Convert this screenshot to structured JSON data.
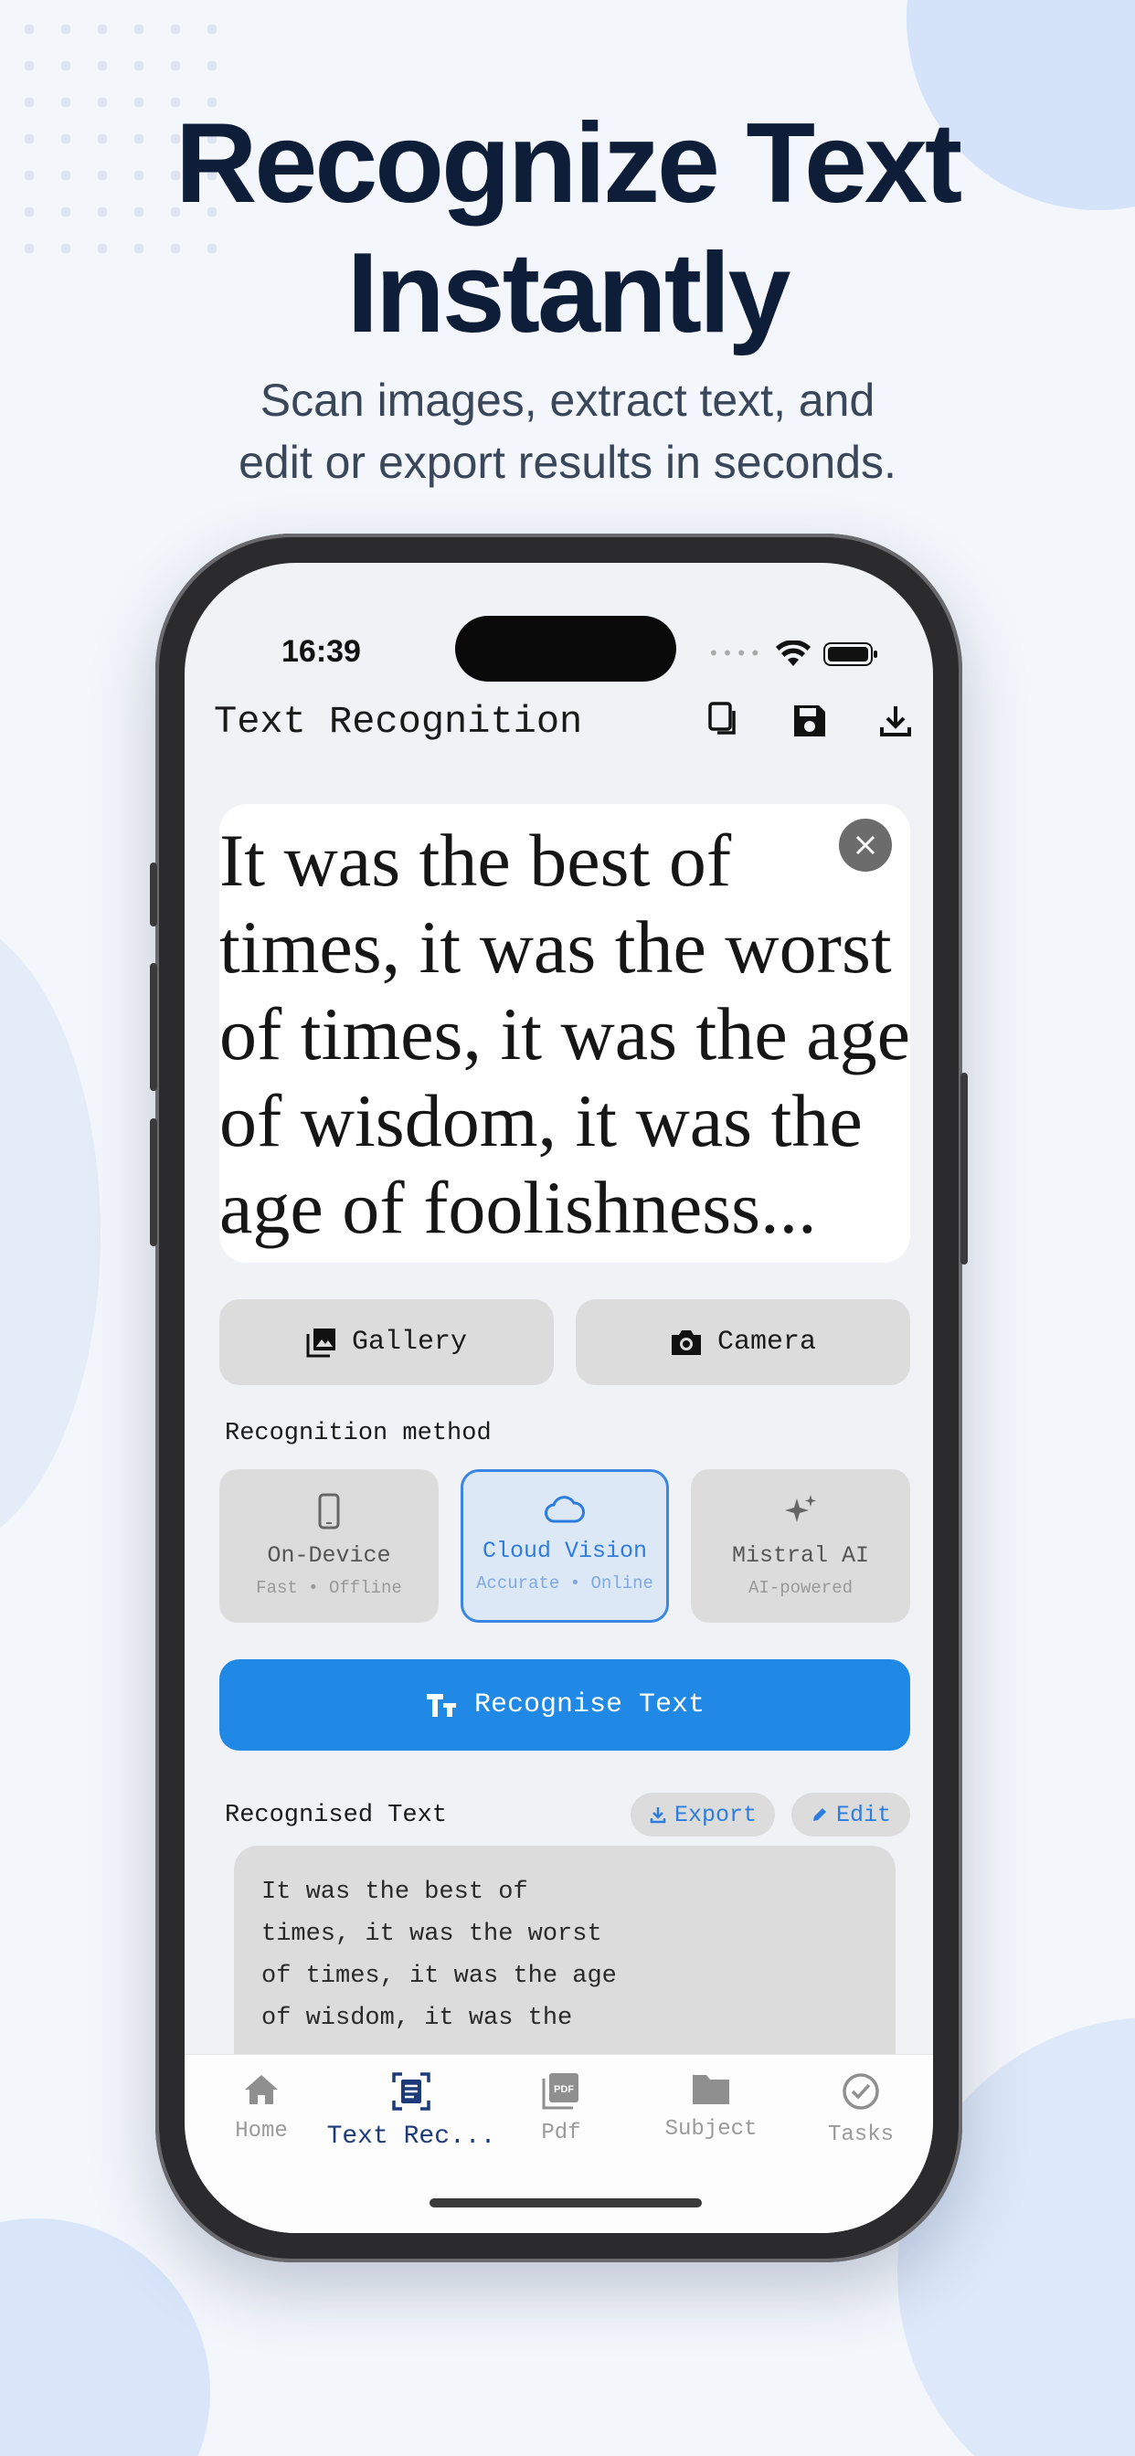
{
  "hero": {
    "headline_line1": "Recognize Text",
    "headline_line2": "Instantly",
    "sub_line1": "Scan images, extract text, and",
    "sub_line2": "edit or export results in seconds."
  },
  "status_bar": {
    "time": "16:39"
  },
  "app_bar": {
    "title": "Text Recognition",
    "icons": [
      "copy-icon",
      "save-icon",
      "download-icon"
    ]
  },
  "preview": {
    "lines": [
      "It was the best of",
      "times, it was the worst",
      "of times, it was the age",
      "of wisdom, it was the",
      "age of foolishness..."
    ]
  },
  "source_buttons": {
    "gallery": "Gallery",
    "camera": "Camera"
  },
  "recognition": {
    "label": "Recognition method",
    "methods": [
      {
        "title": "On-Device",
        "subtitle": "Fast • Offline",
        "icon": "phone-icon",
        "selected": false
      },
      {
        "title": "Cloud Vision",
        "subtitle": "Accurate • Online",
        "icon": "cloud-icon",
        "selected": true
      },
      {
        "title": "Mistral AI",
        "subtitle": "AI-powered",
        "icon": "sparkle-icon",
        "selected": false
      }
    ],
    "action_label": "Recognise Text"
  },
  "result": {
    "label": "Recognised Text",
    "export_label": "Export",
    "edit_label": "Edit",
    "lines": [
      "It was the best of",
      "times, it was the worst",
      "of times, it was the age",
      "of wisdom, it was the"
    ]
  },
  "tabs": [
    {
      "label": "Home",
      "icon": "home-icon",
      "active": false
    },
    {
      "label": "Text Rec...",
      "icon": "document-scan-icon",
      "active": true
    },
    {
      "label": "Pdf",
      "icon": "pdf-icon",
      "active": false
    },
    {
      "label": "Subject",
      "icon": "folder-icon",
      "active": false
    },
    {
      "label": "Tasks",
      "icon": "check-circle-icon",
      "active": false
    }
  ],
  "colors": {
    "accent": "#1f89e5",
    "selected_border": "#3a86e3",
    "headline": "#0e1d38",
    "tab_active": "#1d3a7a"
  }
}
